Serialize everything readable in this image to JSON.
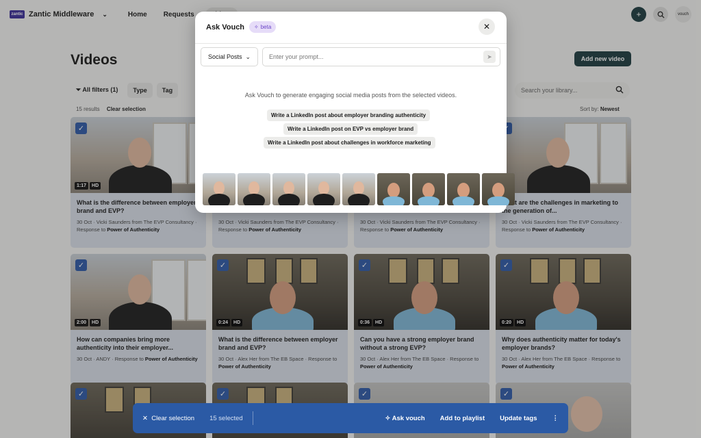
{
  "nav": {
    "org_name": "Zantic Middleware",
    "org_logo_text": "zantic",
    "links": [
      "Home",
      "Requests",
      "Videos"
    ],
    "user_badge": "vouch",
    "icons": {
      "add": "plus-icon",
      "search": "search-icon"
    }
  },
  "page": {
    "title": "Videos",
    "add_button": "Add new video",
    "filters": {
      "all": "All filters (1)",
      "type": "Type",
      "tag": "Tag"
    },
    "search_placeholder": "Search your library...",
    "results": "15 results",
    "clear_selection": "Clear selection",
    "sort_label": "Sort by:",
    "sort_value": "Newest"
  },
  "cards": [
    {
      "title": "What is the difference between employer brand and EVP?",
      "duration": "1:17",
      "quality": "HD",
      "meta_pre": "30 Oct · Vicki Saunders from The EVP Consultancy · Response to ",
      "meta_bold": "Power of Authenticity"
    },
    {
      "title": "",
      "duration": "",
      "quality": "",
      "meta_pre": "30 Oct · Vicki Saunders from The EVP Consultancy · Response to ",
      "meta_bold": "Power of Authenticity"
    },
    {
      "title": "",
      "duration": "",
      "quality": "",
      "meta_pre": "30 Oct · Vicki Saunders from The EVP Consultancy · Response to ",
      "meta_bold": "Power of Authenticity"
    },
    {
      "title": "What are the challenges in marketing to the generation of...",
      "duration": "",
      "quality": "HD",
      "meta_pre": "30 Oct · Vicki Saunders from The EVP Consultancy · Response to ",
      "meta_bold": "Power of Authenticity"
    },
    {
      "title": "How can companies bring more authenticity into their employer...",
      "duration": "2:00",
      "quality": "HD",
      "meta_pre": "30 Oct · ANDY · Response to ",
      "meta_bold": "Power of Authenticity"
    },
    {
      "title": "What is the difference between employer brand and EVP?",
      "duration": "0:24",
      "quality": "HD",
      "meta_pre": "30 Oct · Alex Her from The EB Space · Response to ",
      "meta_bold": "Power of Authenticity"
    },
    {
      "title": "Can you have a strong employer brand without a strong EVP?",
      "duration": "0:36",
      "quality": "HD",
      "meta_pre": "30 Oct · Alex Her from The EB Space · Response to ",
      "meta_bold": "Power of Authenticity"
    },
    {
      "title": "Why does authenticity matter for today's employer brands?",
      "duration": "0:20",
      "quality": "HD",
      "meta_pre": "30 Oct · Alex Her from The EB Space · Response to ",
      "meta_bold": "Power of Authenticity"
    }
  ],
  "modal": {
    "title": "Ask Vouch",
    "beta": "beta",
    "dropdown": "Social Posts",
    "prompt_placeholder": "Enter your prompt...",
    "hint": "Ask Vouch to generate engaging social media posts from the selected videos.",
    "suggestions": [
      "Write a LinkedIn post about employer branding authenticity",
      "Write a LinkedIn post on EVP vs employer brand",
      "Write a LinkedIn post about challenges in workforce marketing"
    ]
  },
  "actionbar": {
    "clear": "Clear selection",
    "selected": "15 selected",
    "ask": "Ask vouch",
    "playlist": "Add to playlist",
    "tags": "Update tags",
    "more": "⋮"
  }
}
